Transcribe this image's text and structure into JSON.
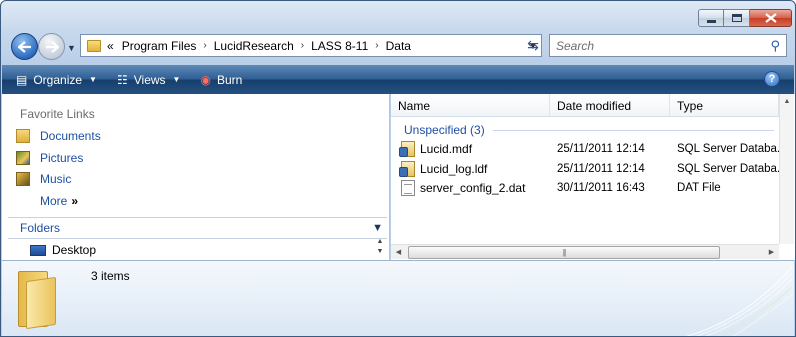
{
  "address": {
    "crumb_lead": "«",
    "crumbs": [
      "Program Files",
      "LucidResearch",
      "LASS 8-11",
      "Data"
    ],
    "crumb_separator": "›"
  },
  "search": {
    "placeholder": "Search"
  },
  "toolbar": {
    "organize_label": "Organize",
    "views_label": "Views",
    "burn_label": "Burn",
    "help_label": "?"
  },
  "nav": {
    "favorites_title": "Favorite Links",
    "favorites": [
      "Documents",
      "Pictures",
      "Music"
    ],
    "more_label": "More",
    "more_arrow": "»",
    "folders_label": "Folders",
    "desktop_label": "Desktop"
  },
  "files": {
    "columns": {
      "name": "Name",
      "date": "Date modified",
      "type": "Type"
    },
    "group_label": "Unspecified (3)",
    "rows": [
      {
        "name": "Lucid.mdf",
        "date": "25/11/2011 12:14",
        "type": "SQL Server Databa...",
        "icon": "database-file-icon"
      },
      {
        "name": "Lucid_log.ldf",
        "date": "25/11/2011 12:14",
        "type": "SQL Server Databa...",
        "icon": "database-file-icon"
      },
      {
        "name": "server_config_2.dat",
        "date": "30/11/2011 16:43",
        "type": "DAT File",
        "icon": "dat-file-icon"
      }
    ]
  },
  "details": {
    "item_count": "3 items"
  },
  "colors": {
    "toolbar": "#24507f",
    "link": "#1e4fa5",
    "close": "#c43f27"
  }
}
